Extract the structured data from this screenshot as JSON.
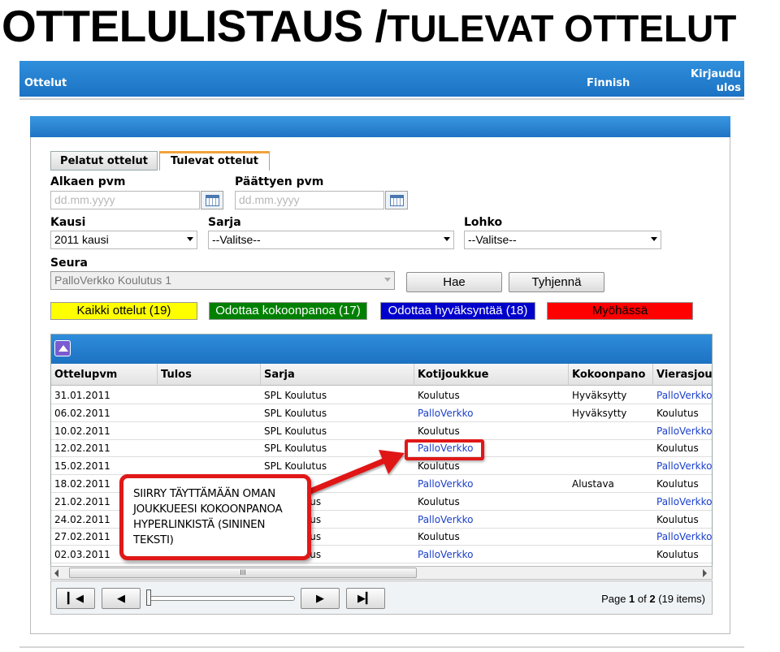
{
  "slide_title": {
    "main": "OTTELULISTAUS /",
    "sub": "TULEVAT OTTELUT"
  },
  "topbar": {
    "left": "Ottelut",
    "language": "Finnish",
    "logout_line1": "Kirjaudu",
    "logout_line2": "ulos"
  },
  "tabs": [
    {
      "label": "Pelatut ottelut",
      "active": false
    },
    {
      "label": "Tulevat ottelut",
      "active": true
    }
  ],
  "filters": {
    "start_label": "Alkaen pvm",
    "start_placeholder": "dd.mm.yyyy",
    "end_label": "Päättyen pvm",
    "end_placeholder": "dd.mm.yyyy",
    "season_label": "Kausi",
    "season_value": "2011 kausi",
    "series_label": "Sarja",
    "series_value": "--Valitse--",
    "group_label": "Lohko",
    "group_value": "--Valitse--",
    "club_label": "Seura",
    "club_value": "PalloVerkko Koulutus 1",
    "search_button": "Hae",
    "clear_button": "Tyhjennä"
  },
  "status_filters": [
    {
      "label": "Kaikki ottelut (19)",
      "bg": "#ffff00",
      "fg": "#000000"
    },
    {
      "label": "Odottaa kokoonpanoa (17)",
      "bg": "#008000",
      "fg": "#ffffff"
    },
    {
      "label": "Odottaa hyväksyntää (18)",
      "bg": "#0000cc",
      "fg": "#ffffff"
    },
    {
      "label": "Myöhässä",
      "bg": "#ff0000",
      "fg": "#000000"
    }
  ],
  "columns": [
    "Ottelupvm",
    "Tulos",
    "Sarja",
    "Kotijoukkue",
    "Kokoonpano",
    "Vierasjoukkue"
  ],
  "rows": [
    {
      "date": "31.01.2011",
      "result": "",
      "series": "SPL Koulutus",
      "home": "Koulutus",
      "home_link": false,
      "lineup": "Hyväksytty",
      "away": "PalloVerkko",
      "away_link": true
    },
    {
      "date": "06.02.2011",
      "result": "",
      "series": "SPL Koulutus",
      "home": "PalloVerkko",
      "home_link": true,
      "lineup": "Hyväksytty",
      "away": "Koulutus",
      "away_link": false
    },
    {
      "date": "10.02.2011",
      "result": "",
      "series": "SPL Koulutus",
      "home": "Koulutus",
      "home_link": false,
      "lineup": "",
      "away": "PalloVerkko",
      "away_link": true
    },
    {
      "date": "12.02.2011",
      "result": "",
      "series": "SPL Koulutus",
      "home": "PalloVerkko",
      "home_link": true,
      "lineup": "",
      "away": "Koulutus",
      "away_link": false
    },
    {
      "date": "15.02.2011",
      "result": "",
      "series": "SPL Koulutus",
      "home": "Koulutus",
      "home_link": false,
      "lineup": "",
      "away": "PalloVerkko",
      "away_link": true
    },
    {
      "date": "18.02.2011",
      "result": "",
      "series": "",
      "home": "PalloVerkko",
      "home_link": true,
      "lineup": "Alustava",
      "away": "Koulutus",
      "away_link": false
    },
    {
      "date": "21.02.2011",
      "result": "",
      "series": "utus",
      "home": "Koulutus",
      "home_link": false,
      "lineup": "",
      "away": "PalloVerkko",
      "away_link": true
    },
    {
      "date": "24.02.2011",
      "result": "",
      "series": "utus",
      "home": "PalloVerkko",
      "home_link": true,
      "lineup": "",
      "away": "Koulutus",
      "away_link": false
    },
    {
      "date": "27.02.2011",
      "result": "",
      "series": "utus",
      "home": "Koulutus",
      "home_link": false,
      "lineup": "",
      "away": "PalloVerkko",
      "away_link": true
    },
    {
      "date": "02.03.2011",
      "result": "",
      "series": "utus",
      "home": "PalloVerkko",
      "home_link": true,
      "lineup": "",
      "away": "Koulutus",
      "away_link": false
    }
  ],
  "scrollbar_grip": "III",
  "pager": {
    "prefix": "Page ",
    "current": "1",
    "of": " of ",
    "total": "2",
    "items": " (19 items)"
  },
  "callout": {
    "text": "SIIRRY TÄYTTÄMÄÄN OMAN JOUKKUEESI KOKOONPANOA HYPERLINKISTÄ (SININEN TEKSTI)"
  }
}
